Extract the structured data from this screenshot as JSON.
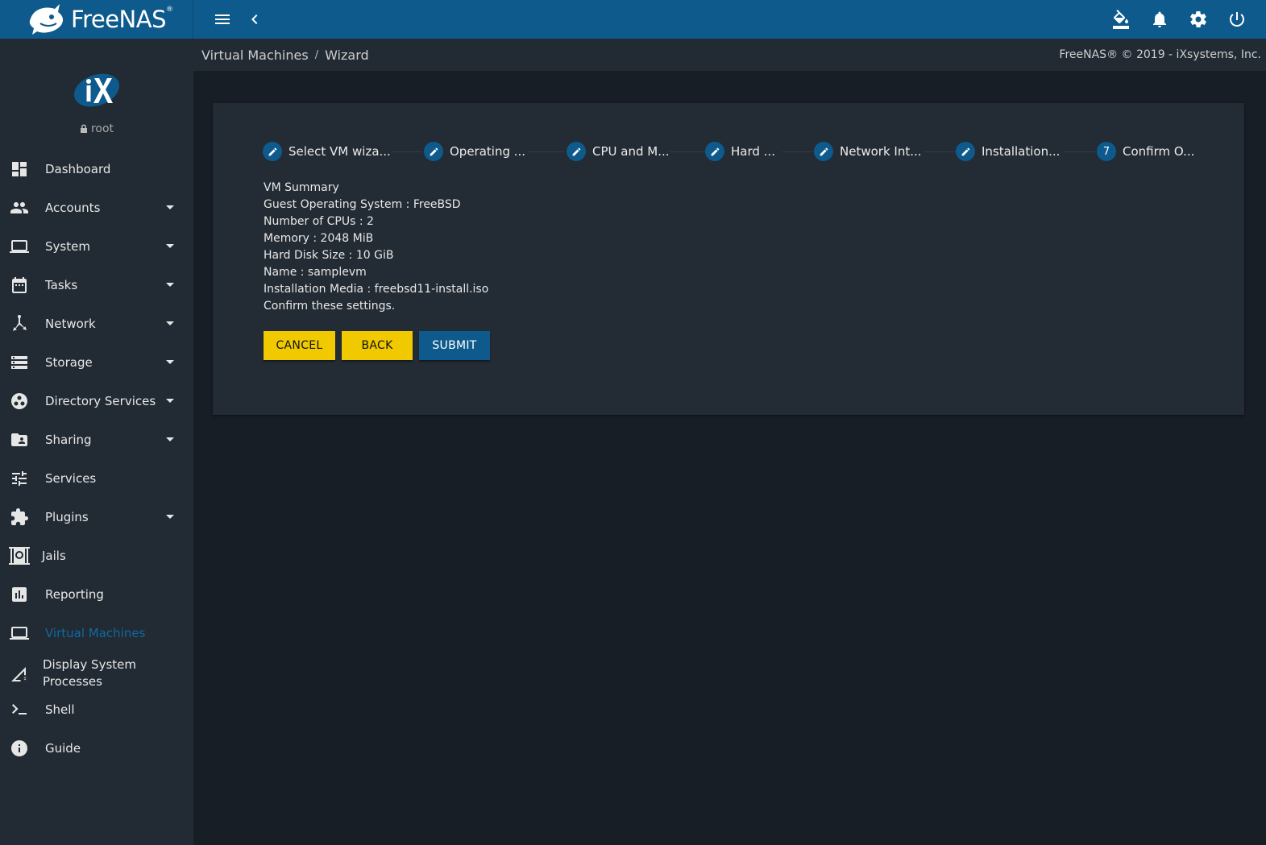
{
  "topbar": {
    "brand_text": "FreeNAS",
    "brand_tm": "®",
    "icons": [
      "menu-icon",
      "chevron-left-icon",
      "theme-bucket-icon",
      "bell-icon",
      "gear-icon",
      "power-icon"
    ]
  },
  "breadcrumb": {
    "items": [
      "Virtual Machines",
      "Wizard"
    ],
    "separator": "/"
  },
  "copyright": "FreeNAS® © 2019 - iXsystems, Inc.",
  "profile": {
    "username": "root"
  },
  "sidebar": {
    "items": [
      {
        "label": "Dashboard",
        "icon": "dashboard-icon"
      },
      {
        "label": "Accounts",
        "icon": "accounts-icon",
        "expandable": true
      },
      {
        "label": "System",
        "icon": "laptop-icon",
        "expandable": true
      },
      {
        "label": "Tasks",
        "icon": "calendar-icon",
        "expandable": true
      },
      {
        "label": "Network",
        "icon": "network-icon",
        "expandable": true
      },
      {
        "label": "Storage",
        "icon": "storage-icon",
        "expandable": true
      },
      {
        "label": "Directory Services",
        "icon": "directory-services-icon",
        "expandable": true
      },
      {
        "label": "Sharing",
        "icon": "folder-shared-icon",
        "expandable": true
      },
      {
        "label": "Services",
        "icon": "tune-icon"
      },
      {
        "label": "Plugins",
        "icon": "extension-icon",
        "expandable": true
      },
      {
        "label": "Jails",
        "icon": "jail-icon"
      },
      {
        "label": "Reporting",
        "icon": "insert-chart-icon"
      },
      {
        "label": "Virtual Machines",
        "icon": "laptop-icon",
        "active": true
      },
      {
        "label": "Display System Processes",
        "icon": "processes-icon"
      },
      {
        "label": "Shell",
        "icon": "shell-icon"
      },
      {
        "label": "Guide",
        "icon": "info-icon"
      }
    ],
    "labels": {
      "processes_line1": "Display System",
      "processes_line2": "Processes"
    }
  },
  "wizard": {
    "steps": [
      {
        "label": "Select VM wiza...",
        "state": "edit"
      },
      {
        "label": "Operating ...",
        "state": "edit"
      },
      {
        "label": "CPU and M...",
        "state": "edit"
      },
      {
        "label": "Hard ...",
        "state": "edit"
      },
      {
        "label": "Network Int...",
        "state": "edit"
      },
      {
        "label": "Installation...",
        "state": "edit"
      },
      {
        "label": "Confirm O...",
        "state": "current",
        "number": "7"
      }
    ],
    "summary": [
      "VM Summary",
      "Guest Operating System : FreeBSD",
      "Number of CPUs : 2",
      "Memory : 2048 MiB",
      "Hard Disk Size : 10 GiB",
      "Name : samplevm",
      "Installation Media : freebsd11-install.iso",
      "Confirm these settings."
    ],
    "buttons": {
      "cancel": "CANCEL",
      "back": "BACK",
      "submit": "SUBMIT"
    }
  },
  "colors": {
    "topbar": "#0e5a8c",
    "sidebar": "#222a33",
    "background": "#181e26",
    "card": "#232b34",
    "accent_yellow": "#f0c900",
    "accent_blue": "#0e5a8c",
    "active_nav": "#0f6aa3"
  }
}
